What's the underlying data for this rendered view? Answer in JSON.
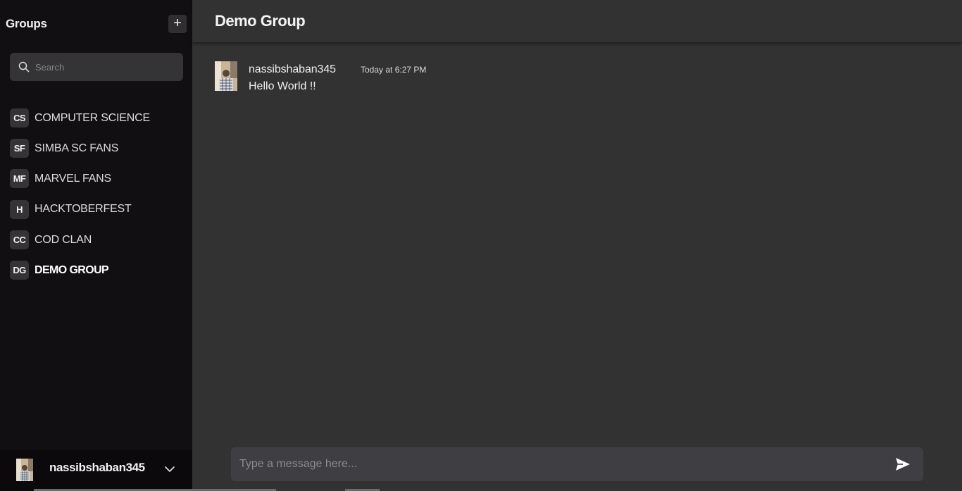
{
  "sidebar": {
    "title": "Groups",
    "add_button_label": "+",
    "search": {
      "placeholder": "Search",
      "value": ""
    },
    "groups": [
      {
        "initials": "CS",
        "name": "COMPUTER SCIENCE",
        "active": false
      },
      {
        "initials": "SF",
        "name": "SIMBA SC FANS",
        "active": false
      },
      {
        "initials": "MF",
        "name": "MARVEL FANS",
        "active": false
      },
      {
        "initials": "H",
        "name": "HACKTOBERFEST",
        "active": false
      },
      {
        "initials": "CC",
        "name": "COD CLAN",
        "active": false
      },
      {
        "initials": "DG",
        "name": "DEMO GROUP",
        "active": true
      }
    ],
    "user": {
      "name": "nassibshaban345",
      "menu_icon": "chevron-down-icon"
    }
  },
  "main": {
    "title": "Demo Group",
    "messages": [
      {
        "author": "nassibshaban345",
        "time": "Today at 6:27 PM",
        "text": "Hello World !!"
      }
    ],
    "composer": {
      "placeholder": "Type a message here...",
      "value": "",
      "send_icon": "send-icon"
    }
  },
  "colors": {
    "sidebar_bg": "#120f12",
    "main_bg": "#333233",
    "input_bg": "#3f3e42",
    "avatar_bg": "#343335"
  }
}
